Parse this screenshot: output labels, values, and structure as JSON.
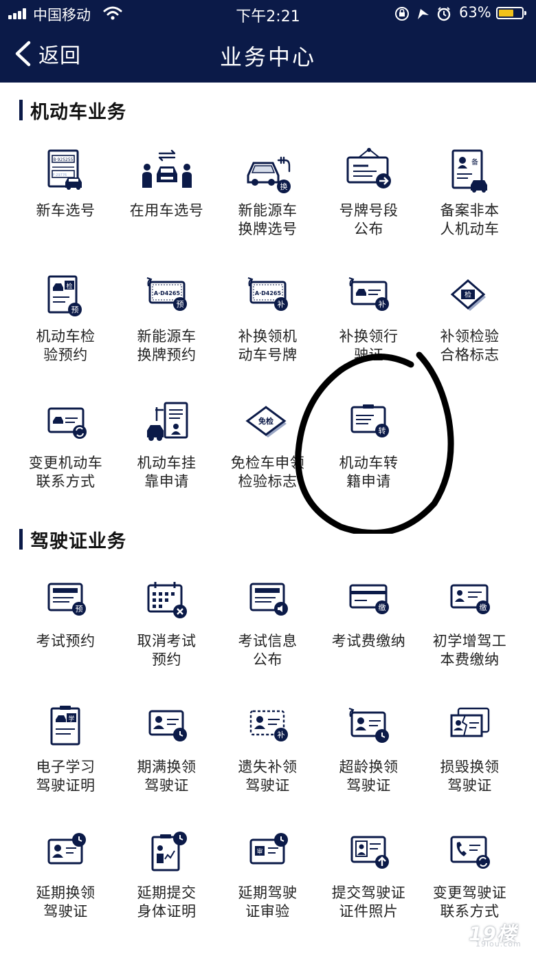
{
  "status_bar": {
    "carrier": "中国移动",
    "time": "下午2:21",
    "battery": "63%"
  },
  "nav": {
    "back_label": "返回",
    "title": "业务中心"
  },
  "colors": {
    "navy": "#0b1a48",
    "text": "#222222",
    "battery": "#f2c21a",
    "scribble": "#000000"
  },
  "sections": [
    {
      "title": "机动车业务",
      "items": [
        {
          "label": "新车选号",
          "icon": "license-plate-car-icon",
          "badge": ""
        },
        {
          "label": "在用车选号",
          "icon": "car-transfer-icon",
          "badge": ""
        },
        {
          "label": "新能源车\n换牌选号",
          "icon": "ev-car-icon",
          "badge": "换"
        },
        {
          "label": "号牌号段\n公布",
          "icon": "announcement-board-icon",
          "badge": ""
        },
        {
          "label": "备案非本\n人机动车",
          "icon": "record-document-icon",
          "badge": "备"
        },
        {
          "label": "机动车检\n验预约",
          "icon": "inspection-doc-icon",
          "badge": "预",
          "tag": "检"
        },
        {
          "label": "新能源车\n换牌预约",
          "icon": "plate-refresh-icon",
          "badge": "预",
          "plate": "A·D4265"
        },
        {
          "label": "补换领机\n动车号牌",
          "icon": "plate-replace-icon",
          "badge": "补",
          "plate": "A·D4265"
        },
        {
          "label": "补换领行\n驶证",
          "icon": "license-replace-icon",
          "badge": "补"
        },
        {
          "label": "补领检验\n合格标志",
          "icon": "inspection-sticker-icon",
          "badge": "",
          "tag": "检"
        },
        {
          "label": "变更机动车\n联系方式",
          "icon": "contact-change-icon",
          "badge": ""
        },
        {
          "label": "机动车挂\n靠申请",
          "icon": "vehicle-affiliation-icon",
          "badge": ""
        },
        {
          "label": "免检车申领\n检验标志",
          "icon": "exempt-sticker-icon",
          "badge": "",
          "tag": "免检"
        },
        {
          "label": "机动车转\n籍申请",
          "icon": "transfer-registration-icon",
          "badge": "转"
        }
      ]
    },
    {
      "title": "驾驶证业务",
      "items": [
        {
          "label": "考试预约",
          "icon": "exam-booking-icon",
          "badge": "预"
        },
        {
          "label": "取消考试\n预约",
          "icon": "calendar-cancel-icon",
          "badge": ""
        },
        {
          "label": "考试信息\n公布",
          "icon": "exam-info-icon",
          "badge": ""
        },
        {
          "label": "考试费缴纳",
          "icon": "exam-fee-icon",
          "badge": "缴"
        },
        {
          "label": "初学增驾工\n本费缴纳",
          "icon": "learner-fee-icon",
          "badge": "缴"
        },
        {
          "label": "电子学习\n驾驶证明",
          "icon": "study-certificate-icon",
          "badge": "",
          "tag": "学"
        },
        {
          "label": "期满换领\n驾驶证",
          "icon": "license-expiry-icon",
          "badge": ""
        },
        {
          "label": "遗失补领\n驾驶证",
          "icon": "license-lost-icon",
          "badge": "补"
        },
        {
          "label": "超龄换领\n驾驶证",
          "icon": "license-overage-icon",
          "badge": ""
        },
        {
          "label": "损毁换领\n驾驶证",
          "icon": "license-damaged-icon",
          "badge": ""
        },
        {
          "label": "延期换领\n驾驶证",
          "icon": "license-delay-icon",
          "badge": ""
        },
        {
          "label": "延期提交\n身体证明",
          "icon": "health-proof-icon",
          "badge": ""
        },
        {
          "label": "延期驾驶\n证审验",
          "icon": "license-audit-icon",
          "badge": "",
          "tag": "审"
        },
        {
          "label": "提交驾驶证\n证件照片",
          "icon": "photo-upload-icon",
          "badge": ""
        },
        {
          "label": "变更驾驶证\n联系方式",
          "icon": "phone-contact-icon",
          "badge": ""
        }
      ]
    }
  ],
  "watermark": {
    "big": "19楼",
    "small": "19lou.com"
  }
}
